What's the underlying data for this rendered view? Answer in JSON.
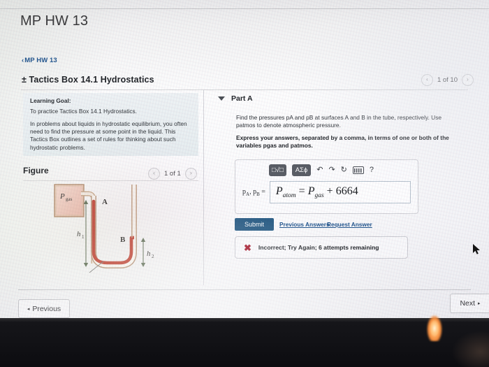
{
  "header": {
    "app_title": "MP HW 13",
    "breadcrumb_chevron": "‹",
    "breadcrumb": "MP HW 13",
    "assignment_title": "± Tactics Box 14.1 Hydrostatics",
    "pager": {
      "prev": "‹",
      "label": "1 of 10",
      "next": "›"
    }
  },
  "left": {
    "learning_goal_heading": "Learning Goal:",
    "learning_goal_line1": "To practice Tactics Box 14.1 Hydrostatics.",
    "learning_goal_line2": "In problems about liquids in hydrostatic equilibrium, you often need to find the pressure at some point in the liquid. This Tactics Box outlines a set of rules for thinking about such hydrostatic problems.",
    "figure_heading": "Figure",
    "figure_pager": {
      "prev": "‹",
      "label": "1 of 1",
      "next": "›"
    },
    "figure_labels": {
      "gas": "P",
      "gas_sub": "gas",
      "point_a": "A",
      "point_b": "B",
      "h1": "h",
      "h1_sub": "1",
      "h2": "h",
      "h2_sub": "2"
    }
  },
  "part": {
    "label": "Part A",
    "collapse_icon": "▼",
    "question": "Find the pressures pA and pB at surfaces A and B in the tube, respectively. Use patmos to denote atmospheric pressure.",
    "instruction": "Express your answers, separated by a comma, in terms of one or both of the variables pgas and patmos.",
    "answer": {
      "field_label_a": "p",
      "field_label_a_sub": "A",
      "field_label_sep": ",",
      "field_label_b": "p",
      "field_label_b_sub": "B",
      "field_label_eq": "=",
      "value_1": "P",
      "value_1_sub": "atom",
      "value_op_1": "=",
      "value_2": "P",
      "value_2_sub": "gas",
      "value_op_2": "+",
      "value_3": "6664"
    },
    "toolbar": {
      "template_button": "□√□",
      "symbols_button": "ΑΣϕ",
      "undo_icon": "↶",
      "redo_icon": "↷",
      "reset_icon": "↻",
      "keyboard_icon": "keyboard-icon",
      "help_icon": "?"
    },
    "submit_label": "Submit",
    "previous_answers_label": "Previous Answers",
    "request_answer_label": "Request Answer",
    "alert": {
      "icon": "✖",
      "text": "Incorrect; Try Again; 6 attempts remaining"
    }
  },
  "footer": {
    "previous_arrow": "◂",
    "previous_label": "Previous",
    "next_label": "Next",
    "next_arrow": "▸"
  },
  "colors": {
    "accent_link": "#24578f",
    "submit_bg": "#2c5f87",
    "error": "#a5192c",
    "liquid": "#c0392b",
    "gas_fill": "#f0bfb4"
  }
}
